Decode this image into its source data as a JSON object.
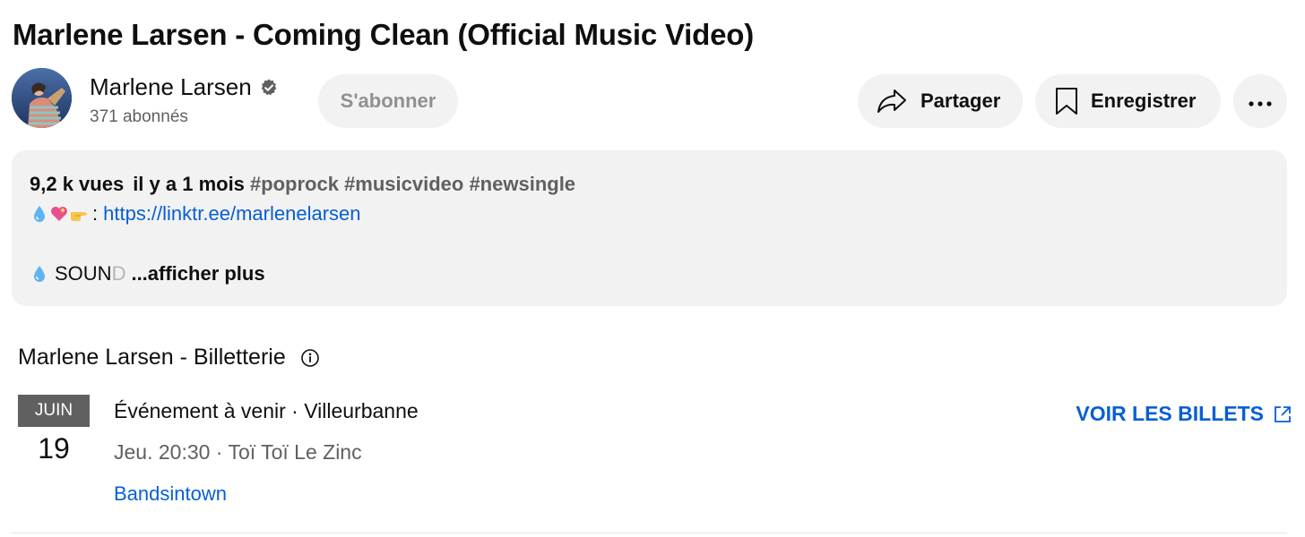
{
  "video": {
    "title": "Marlene Larsen - Coming Clean (Official Music Video)"
  },
  "channel": {
    "name": "Marlene Larsen",
    "subscribers": "371 abonnés",
    "verified_icon": "verified-badge-icon"
  },
  "actions": {
    "subscribe_label": "S'abonner",
    "share_label": "Partager",
    "save_label": "Enregistrer",
    "more_icon": "more-horizontal-icon"
  },
  "description": {
    "views": "9,2 k vues",
    "age": "il y a 1 mois",
    "hashtags": "#poprock #musicvideo #newsingle",
    "link_prefix": ":",
    "link": "https://linktr.ee/marlenelarsen",
    "sound_text": "SOUN",
    "sound_text_fade": "D",
    "show_more": "...afficher plus"
  },
  "ticketing": {
    "title": "Marlene Larsen - Billetterie",
    "event": {
      "month": "JUIN",
      "day": "19",
      "title": "Événement à venir · Villeurbanne",
      "details": "Jeu. 20:30 · Toï Toï Le Zinc",
      "source": "Bandsintown",
      "tickets_label": "VOIR LES BILLETS"
    }
  },
  "colors": {
    "link": "#065fd4",
    "pill_bg": "#f2f2f2",
    "secondary_text": "#606060"
  }
}
